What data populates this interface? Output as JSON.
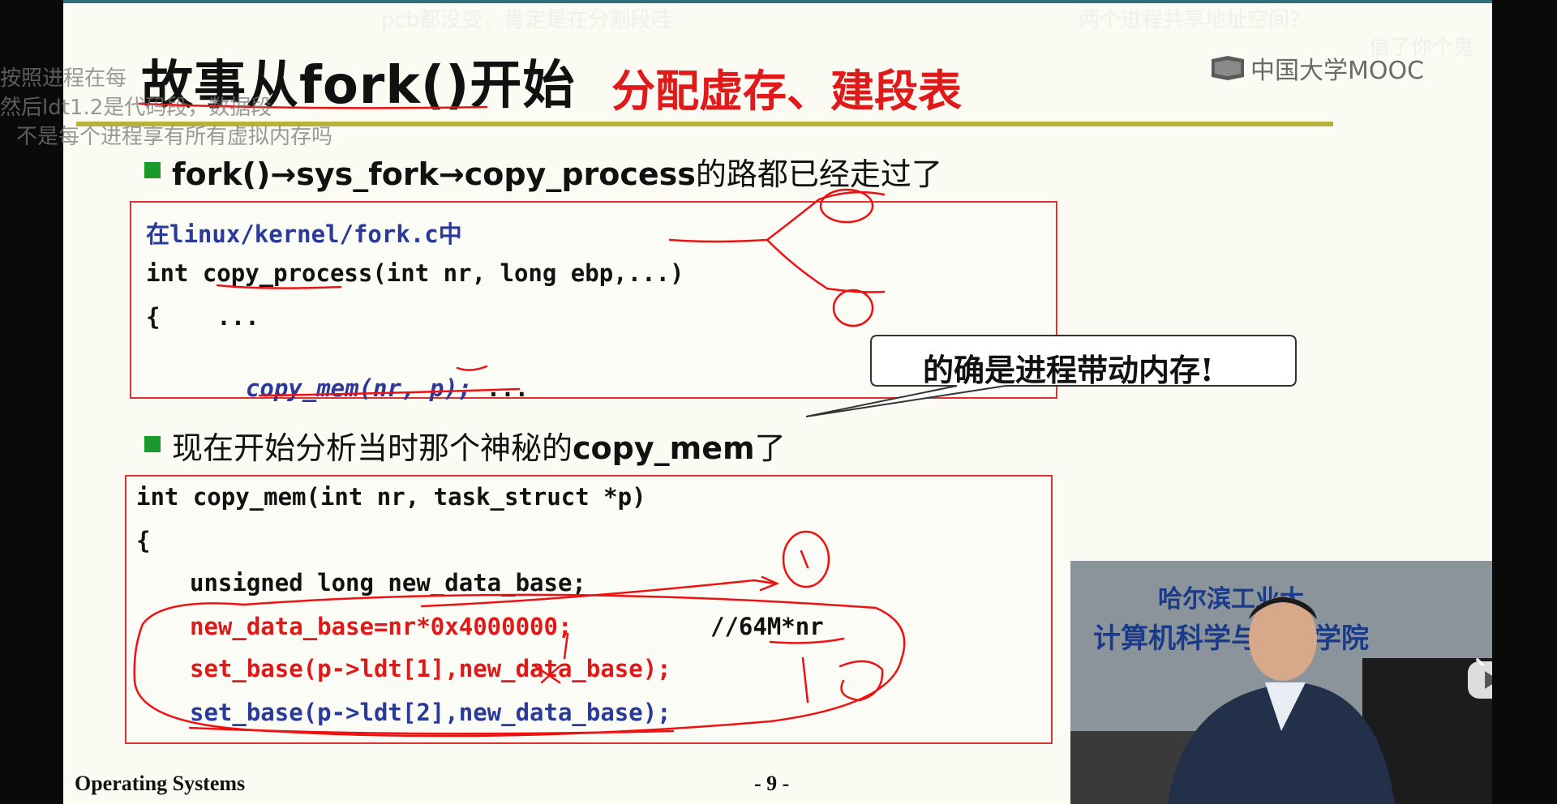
{
  "slide": {
    "title": "故事从fork()开始",
    "subtitle": "分配虚存、建段表",
    "logo": "中国大学MOOC",
    "bullet1": {
      "text_bold": "fork()→sys_fork→copy_process",
      "text_rest": "的路都已经走过了"
    },
    "code1": {
      "line1": "在linux/kernel/fork.c中",
      "line2": "int copy_process(int nr, long ebp,...)",
      "line3": "{    ...",
      "line4_call": "copy_mem(nr, p);",
      "line4_rest": " ..."
    },
    "callout": "的确是进程带动内存!",
    "bullet2": {
      "text_pre": "现在开始分析当时那个神秘的",
      "text_bold": "copy_mem",
      "text_post": "了"
    },
    "code2": {
      "line1": "int copy_mem(int nr, task_struct *p)",
      "line2": "{",
      "line3": "unsigned long new_data_base;",
      "line4": "new_data_base=nr*0x4000000;",
      "line4_comment": "//64M*nr",
      "line5": "set_base(p->ldt[1],new_data_base);",
      "line6": "set_base(p->ldt[2],new_data_base);"
    },
    "footer_left": "Operating Systems",
    "footer_page": "- 9 -"
  },
  "danmaku": [
    "pcb都没变，肯定是在分割段哇",
    "两个进程共享地址空间？",
    "信了你个鬼",
    "按照进程在每",
    "然后ldt1.2是代码段，数据段",
    "不是每个进程享有所有虚拟内存吗"
  ],
  "video": {
    "banner_top": "哈尔滨工业大",
    "banner_main": "计算机科学与技术学院"
  },
  "colors": {
    "title_red": "#e01a1a",
    "code_blue": "#2a3a9a",
    "box_border": "#dd3333",
    "bullet_green": "#1a9a2a",
    "rule_olive": "#b8b13a"
  }
}
